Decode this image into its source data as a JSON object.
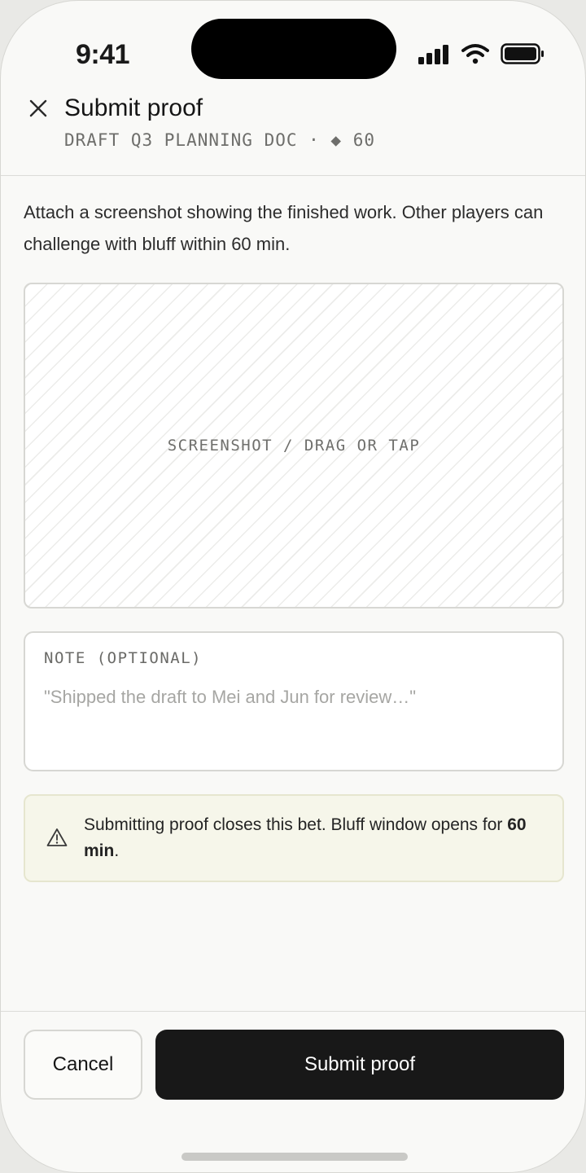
{
  "status_bar": {
    "time": "9:41",
    "icons": [
      "signal-icon",
      "wifi-icon",
      "battery-icon"
    ]
  },
  "header": {
    "close_icon": "close-icon",
    "title": "Submit proof",
    "subtitle": "DRAFT Q3 PLANNING DOC · ◆ 60"
  },
  "main": {
    "description": "Attach a screenshot showing the finished work. Other players can challenge with bluff within 60 min.",
    "dropzone_label": "SCREENSHOT / DRAG OR TAP",
    "note": {
      "label": "NOTE (OPTIONAL)",
      "placeholder": "\"Shipped the draft to Mei and Jun for review…\"",
      "value": ""
    },
    "warning": {
      "icon": "warning-icon",
      "text_before": "Submitting proof closes this bet. Bluff window opens for ",
      "emphasis": "60 min",
      "text_after": "."
    }
  },
  "footer": {
    "cancel_label": "Cancel",
    "submit_label": "Submit proof"
  },
  "colors": {
    "background": "#f9f9f7",
    "primary_button": "#181818",
    "warning_background": "#f6f6ea",
    "border": "#d7d7d3"
  }
}
